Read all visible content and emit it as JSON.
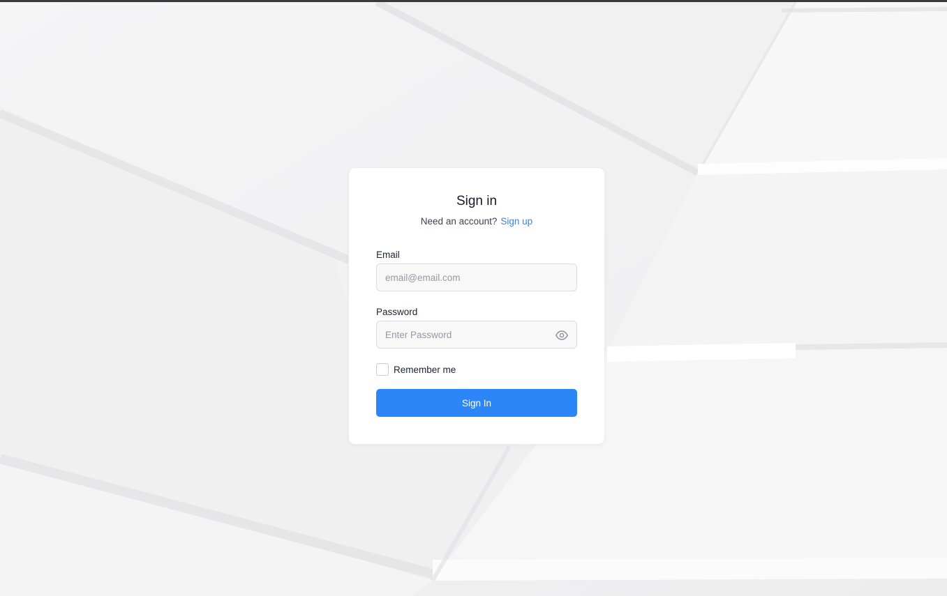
{
  "signin": {
    "title": "Sign in",
    "prompt": "Need an account?",
    "signup_link": "Sign up",
    "email_label": "Email",
    "email_placeholder": "email@email.com",
    "email_value": "",
    "password_label": "Password",
    "password_placeholder": "Enter Password",
    "password_value": "",
    "remember_label": "Remember me",
    "remember_checked": false,
    "submit_label": "Sign In"
  },
  "icons": {
    "password_toggle": "eye-icon"
  },
  "colors": {
    "accent": "#2d86f7",
    "link": "#2d86f0",
    "background": "#f3f3f4",
    "card": "#ffffff"
  }
}
